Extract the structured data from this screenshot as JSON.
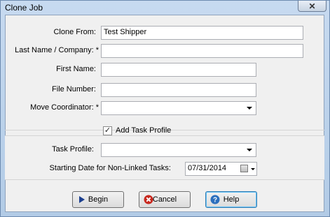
{
  "window": {
    "title": "Clone Job",
    "close_glyph": "✕"
  },
  "form": {
    "clone_from": {
      "label": "Clone From:",
      "value": "Test Shipper"
    },
    "last_name_company": {
      "label": "Last Name / Company: *",
      "value": ""
    },
    "first_name": {
      "label": "First Name:",
      "value": ""
    },
    "file_number": {
      "label": "File Number:",
      "value": ""
    },
    "move_coordinator": {
      "label": "Move Coordinator: *",
      "value": ""
    },
    "add_task_profile": {
      "label": "Add Task Profile",
      "checked": true,
      "check_glyph": "✓"
    },
    "task_profile": {
      "label": "Task Profile:",
      "value": ""
    },
    "starting_date": {
      "label": "Starting Date for Non-Linked Tasks:",
      "value": "07/31/2014"
    }
  },
  "buttons": {
    "begin": {
      "label": "Begin",
      "icon": "play-arrow-icon"
    },
    "cancel": {
      "label": "Cancel",
      "icon": "cancel-x-icon"
    },
    "help": {
      "label": "Help",
      "icon": "help-question-icon"
    }
  },
  "colors": {
    "begin_icon": "#1c3f8f",
    "cancel_icon": "#c8281e",
    "help_icon": "#2b6fbe"
  }
}
